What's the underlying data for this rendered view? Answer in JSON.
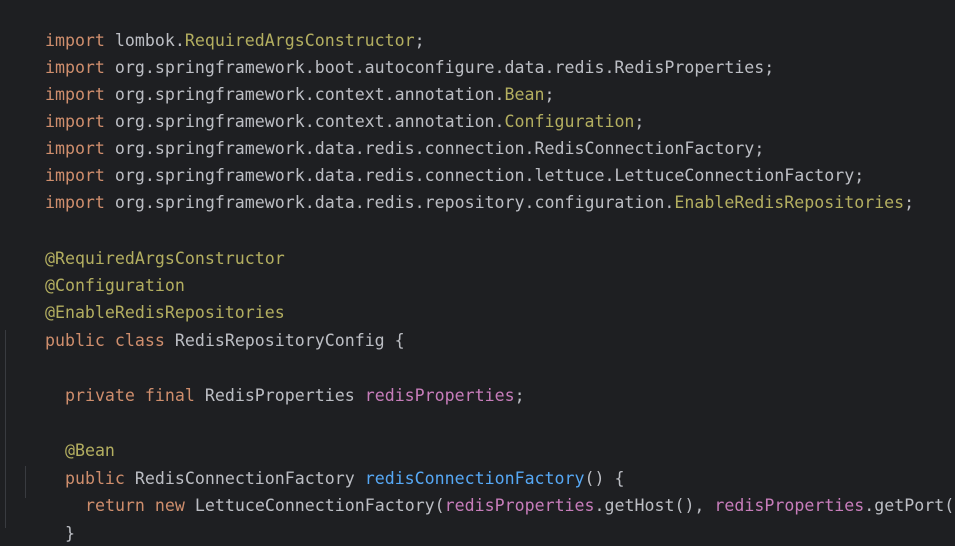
{
  "code": {
    "imports": [
      {
        "kw": "import",
        "pkg": "lombok.",
        "cls": "RequiredArgsConstructor",
        "semi": ";"
      },
      {
        "kw": "import",
        "pkg": "org.springframework.boot.autoconfigure.data.redis.RedisProperties",
        "cls": "",
        "semi": ";"
      },
      {
        "kw": "import",
        "pkg": "org.springframework.context.annotation.",
        "cls": "Bean",
        "semi": ";"
      },
      {
        "kw": "import",
        "pkg": "org.springframework.context.annotation.",
        "cls": "Configuration",
        "semi": ";"
      },
      {
        "kw": "import",
        "pkg": "org.springframework.data.redis.connection.RedisConnectionFactory",
        "cls": "",
        "semi": ";"
      },
      {
        "kw": "import",
        "pkg": "org.springframework.data.redis.connection.lettuce.LettuceConnectionFactory",
        "cls": "",
        "semi": ";"
      },
      {
        "kw": "import",
        "pkg": "org.springframework.data.redis.repository.configuration.",
        "cls": "EnableRedisRepositories",
        "semi": ";"
      }
    ],
    "annotations": [
      "@RequiredArgsConstructor",
      "@Configuration",
      "@EnableRedisRepositories"
    ],
    "class_decl": {
      "kw1": "public",
      "kw2": "class",
      "name": "RedisRepositoryConfig {"
    },
    "field": {
      "kw1": "private",
      "kw2": "final",
      "type": "RedisProperties",
      "name": "redisProperties",
      "semi": ";"
    },
    "bean_annotation": "@Bean",
    "method_decl": {
      "kw": "public",
      "type": "RedisConnectionFactory",
      "name": "redisConnectionFactory",
      "rest": "() {"
    },
    "return_stmt": {
      "kw1": "return",
      "kw2": "new",
      "call": "LettuceConnectionFactory(",
      "arg1": "redisProperties",
      "get1": ".getHost(), ",
      "arg2": "redisProperties",
      "get2": ".getPort());"
    },
    "method_close": "}",
    "class_close": "}"
  }
}
